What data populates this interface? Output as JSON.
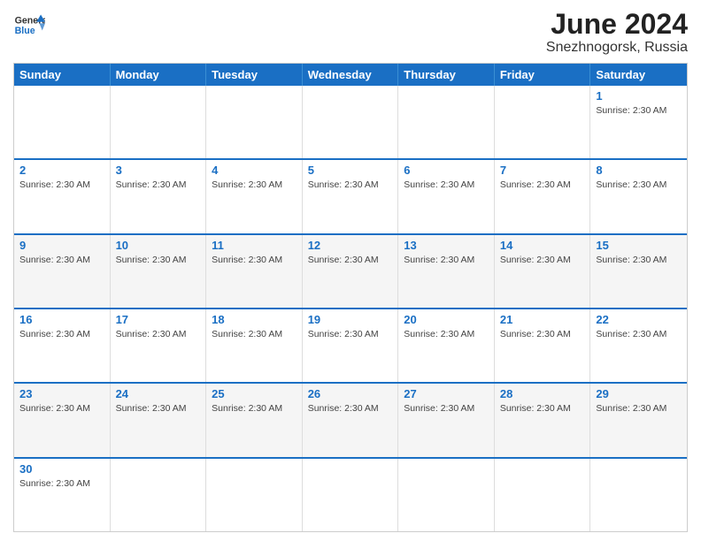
{
  "header": {
    "logo_general": "General",
    "logo_blue": "Blue",
    "month_title": "June 2024",
    "location": "Snezhnogorsk, Russia"
  },
  "calendar": {
    "days_of_week": [
      "Sunday",
      "Monday",
      "Tuesday",
      "Wednesday",
      "Thursday",
      "Friday",
      "Saturday"
    ],
    "sunrise": "Sunrise: 2:30 AM",
    "rows": [
      {
        "alt": false,
        "cells": [
          {
            "day": "",
            "info": ""
          },
          {
            "day": "",
            "info": ""
          },
          {
            "day": "",
            "info": ""
          },
          {
            "day": "",
            "info": ""
          },
          {
            "day": "",
            "info": ""
          },
          {
            "day": "",
            "info": ""
          },
          {
            "day": "1",
            "info": "Sunrise: 2:30 AM"
          }
        ]
      },
      {
        "alt": false,
        "cells": [
          {
            "day": "2",
            "info": "Sunrise: 2:30 AM"
          },
          {
            "day": "3",
            "info": "Sunrise: 2:30 AM"
          },
          {
            "day": "4",
            "info": "Sunrise: 2:30 AM"
          },
          {
            "day": "5",
            "info": "Sunrise: 2:30 AM"
          },
          {
            "day": "6",
            "info": "Sunrise: 2:30 AM"
          },
          {
            "day": "7",
            "info": "Sunrise: 2:30 AM"
          },
          {
            "day": "8",
            "info": "Sunrise: 2:30 AM"
          }
        ]
      },
      {
        "alt": true,
        "cells": [
          {
            "day": "9",
            "info": "Sunrise: 2:30 AM"
          },
          {
            "day": "10",
            "info": "Sunrise: 2:30 AM"
          },
          {
            "day": "11",
            "info": "Sunrise: 2:30 AM"
          },
          {
            "day": "12",
            "info": "Sunrise: 2:30 AM"
          },
          {
            "day": "13",
            "info": "Sunrise: 2:30 AM"
          },
          {
            "day": "14",
            "info": "Sunrise: 2:30 AM"
          },
          {
            "day": "15",
            "info": "Sunrise: 2:30 AM"
          }
        ]
      },
      {
        "alt": false,
        "cells": [
          {
            "day": "16",
            "info": "Sunrise: 2:30 AM"
          },
          {
            "day": "17",
            "info": "Sunrise: 2:30 AM"
          },
          {
            "day": "18",
            "info": "Sunrise: 2:30 AM"
          },
          {
            "day": "19",
            "info": "Sunrise: 2:30 AM"
          },
          {
            "day": "20",
            "info": "Sunrise: 2:30 AM"
          },
          {
            "day": "21",
            "info": "Sunrise: 2:30 AM"
          },
          {
            "day": "22",
            "info": "Sunrise: 2:30 AM"
          }
        ]
      },
      {
        "alt": true,
        "cells": [
          {
            "day": "23",
            "info": "Sunrise: 2:30 AM"
          },
          {
            "day": "24",
            "info": "Sunrise: 2:30 AM"
          },
          {
            "day": "25",
            "info": "Sunrise: 2:30 AM"
          },
          {
            "day": "26",
            "info": "Sunrise: 2:30 AM"
          },
          {
            "day": "27",
            "info": "Sunrise: 2:30 AM"
          },
          {
            "day": "28",
            "info": "Sunrise: 2:30 AM"
          },
          {
            "day": "29",
            "info": "Sunrise: 2:30 AM"
          }
        ]
      },
      {
        "alt": false,
        "cells": [
          {
            "day": "30",
            "info": "Sunrise: 2:30 AM"
          },
          {
            "day": "",
            "info": ""
          },
          {
            "day": "",
            "info": ""
          },
          {
            "day": "",
            "info": ""
          },
          {
            "day": "",
            "info": ""
          },
          {
            "day": "",
            "info": ""
          },
          {
            "day": "",
            "info": ""
          }
        ]
      }
    ]
  }
}
